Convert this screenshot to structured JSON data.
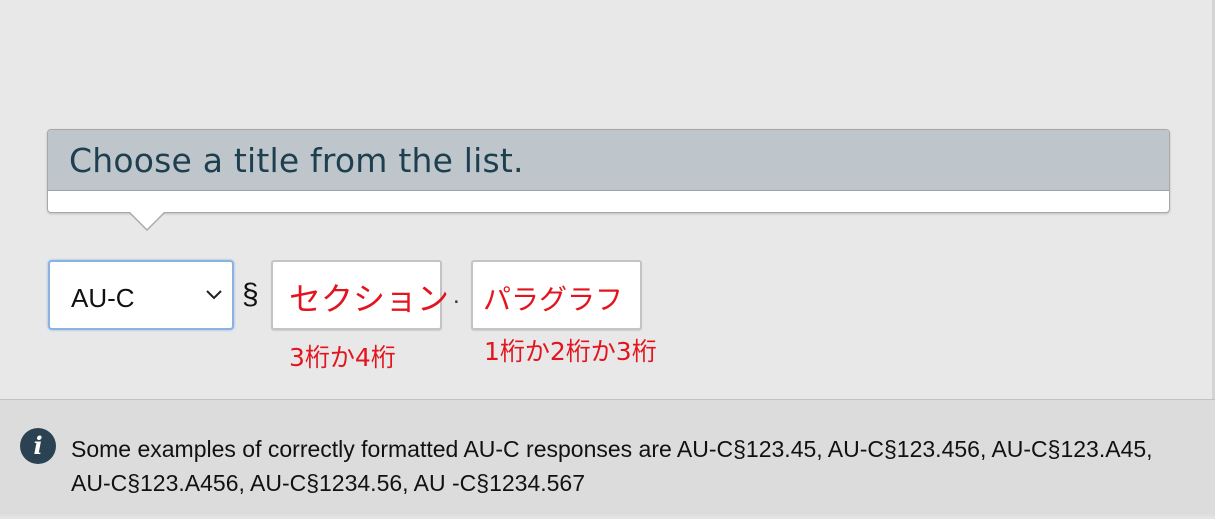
{
  "tooltip": {
    "title": "Choose a title from the list."
  },
  "citation": {
    "select": {
      "value": "AU-C"
    },
    "section_symbol": "§",
    "section_input": {
      "placeholder": "セクション",
      "hint": "3桁か4桁"
    },
    "separator": ".",
    "paragraph_input": {
      "placeholder": "パラグラフ",
      "hint": "1桁か2桁か3桁"
    }
  },
  "info": {
    "icon": "info-icon",
    "text": "Some examples of correctly formatted AU-C responses are AU-C§123.45, AU-C§123.456, AU-C§123.A45, AU-C§123.A456, AU-C§1234.56, AU -C§1234.567"
  },
  "colors": {
    "hint_red": "#e4141e",
    "tooltip_header": "#bfc6cb",
    "select_focus_border": "#8ab3e3",
    "info_icon_bg": "#2a4252"
  }
}
